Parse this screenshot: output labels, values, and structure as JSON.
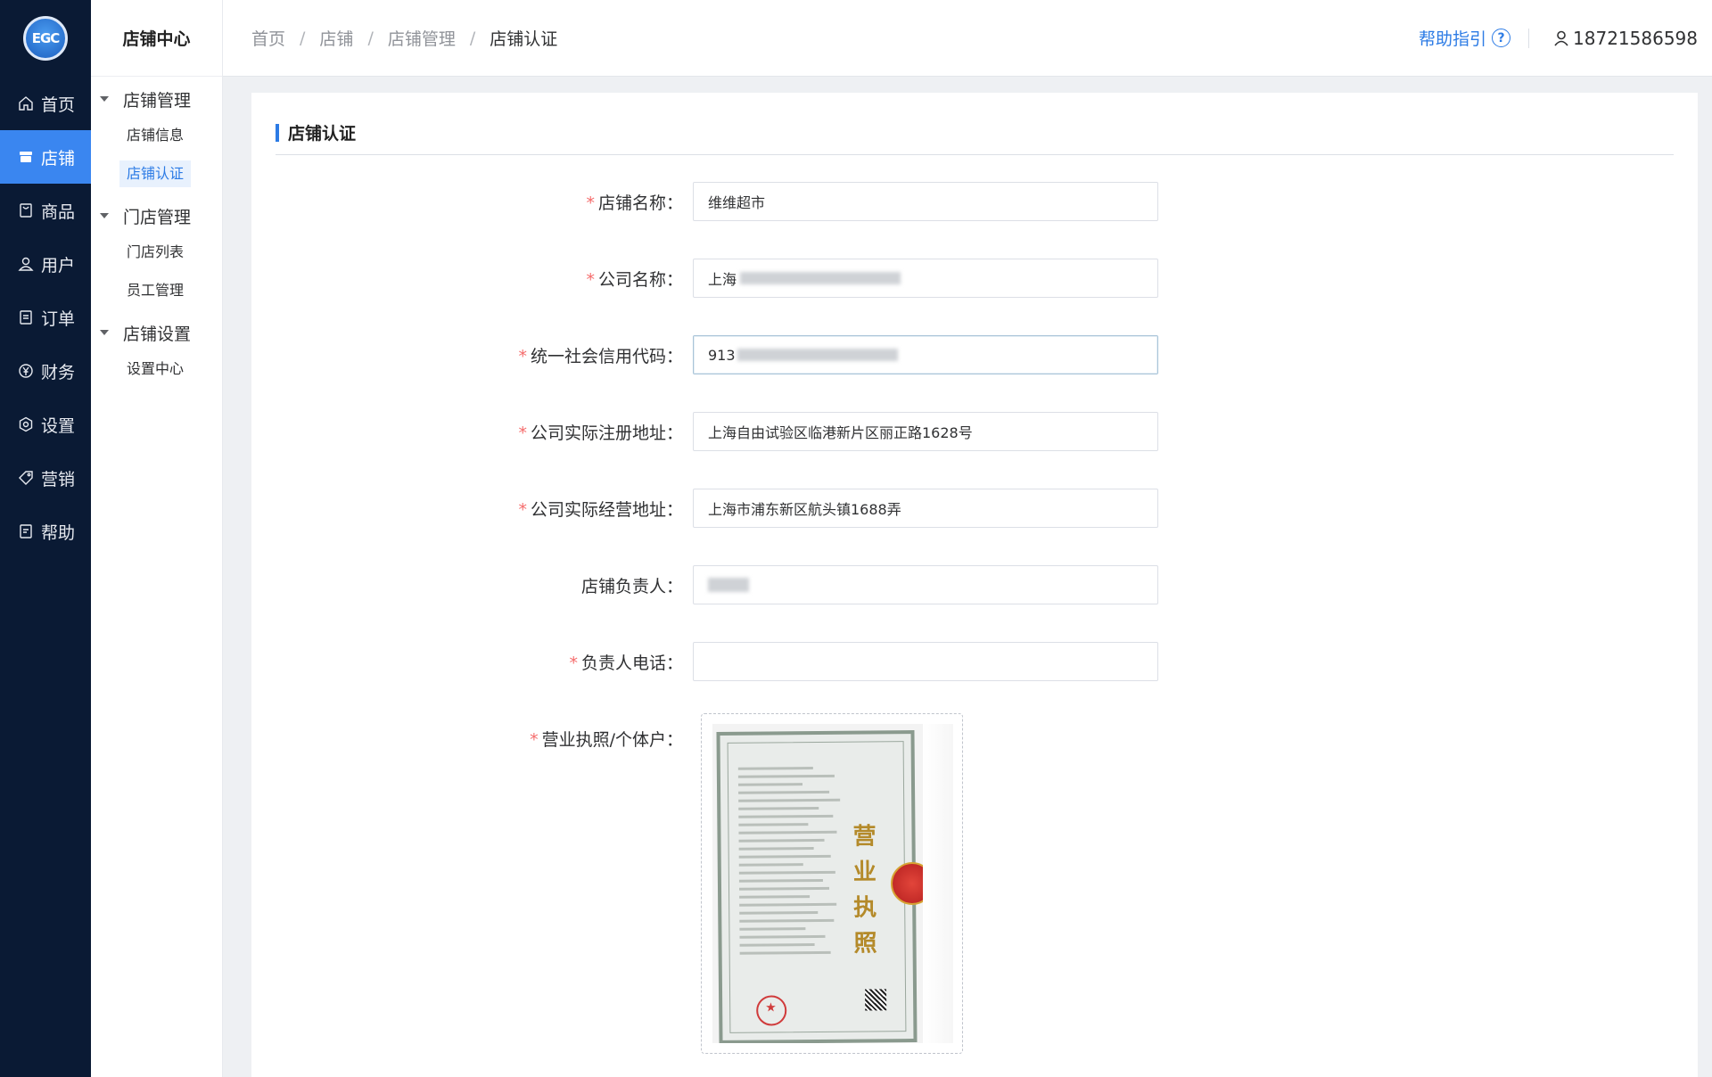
{
  "nav": {
    "logo_text": "EGC",
    "items": [
      {
        "label": "首页",
        "icon": "home-icon",
        "active": false
      },
      {
        "label": "店铺",
        "icon": "store-icon",
        "active": true
      },
      {
        "label": "商品",
        "icon": "bag-icon",
        "active": false
      },
      {
        "label": "用户",
        "icon": "user-icon",
        "active": false
      },
      {
        "label": "订单",
        "icon": "order-icon",
        "active": false
      },
      {
        "label": "财务",
        "icon": "yuan-icon",
        "active": false
      },
      {
        "label": "设置",
        "icon": "gear-icon",
        "active": false
      },
      {
        "label": "营销",
        "icon": "tag-icon",
        "active": false
      },
      {
        "label": "帮助",
        "icon": "doc-icon",
        "active": false
      }
    ]
  },
  "submenu": {
    "title": "店铺中心",
    "groups": [
      {
        "label": "店铺管理",
        "items": [
          {
            "label": "店铺信息"
          },
          {
            "label": "店铺认证"
          }
        ]
      },
      {
        "label": "门店管理",
        "items": [
          {
            "label": "门店列表"
          },
          {
            "label": "员工管理"
          }
        ]
      },
      {
        "label": "店铺设置",
        "items": [
          {
            "label": "设置中心"
          }
        ]
      }
    ],
    "active_item": "店铺认证"
  },
  "header": {
    "breadcrumb": [
      "首页",
      "店铺",
      "店铺管理",
      "店铺认证"
    ],
    "separator": "/",
    "help_label": "帮助指引",
    "help_icon": "question-circle-icon",
    "username": "18721586598"
  },
  "colors": {
    "nav_bg": "#0a1a34",
    "accent": "#2c7be5",
    "active_nav": "#3a86f0",
    "required": "#f56c6c"
  },
  "card": {
    "title": "店铺认证",
    "fields": [
      {
        "label": "店铺名称",
        "required": true,
        "value": "维维超市"
      },
      {
        "label": "公司名称",
        "required": true,
        "value": "上海"
      },
      {
        "label": "统一社会信用代码",
        "required": true,
        "value": "913"
      },
      {
        "label": "公司实际注册地址",
        "required": true,
        "value": "上海自由试验区临港新片区丽正路1628号"
      },
      {
        "label": "公司实际经营地址",
        "required": true,
        "value": "上海市浦东新区航头镇1688弄"
      },
      {
        "label": "店铺负责人",
        "required": false,
        "value": ""
      },
      {
        "label": "负责人电话",
        "required": true,
        "value": ""
      },
      {
        "label": "营业执照/个体户",
        "required": true,
        "value": ""
      }
    ],
    "license_image": {
      "title_text": "营业执照"
    }
  }
}
